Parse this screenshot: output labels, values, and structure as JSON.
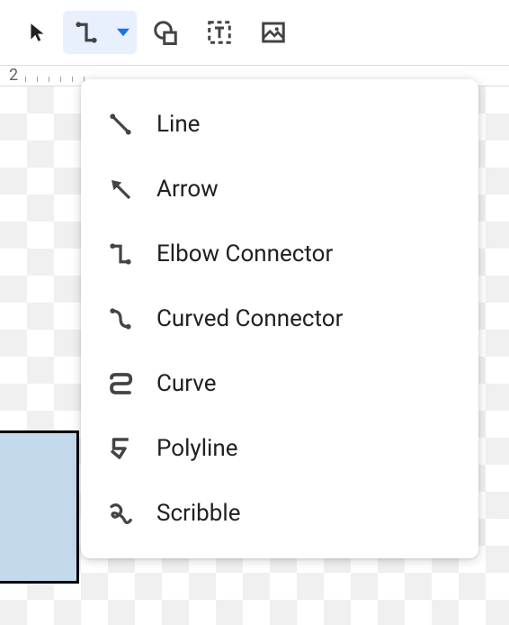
{
  "toolbar": {
    "select": "Select",
    "line": "Line",
    "shape": "Shape",
    "textbox": "Text box",
    "image": "Image"
  },
  "ruler": {
    "label": "2"
  },
  "menu": {
    "items": [
      {
        "id": "line",
        "label": "Line"
      },
      {
        "id": "arrow",
        "label": "Arrow"
      },
      {
        "id": "elbow",
        "label": "Elbow Connector"
      },
      {
        "id": "curved",
        "label": "Curved Connector"
      },
      {
        "id": "curve",
        "label": "Curve"
      },
      {
        "id": "polyline",
        "label": "Polyline"
      },
      {
        "id": "scribble",
        "label": "Scribble"
      }
    ]
  }
}
